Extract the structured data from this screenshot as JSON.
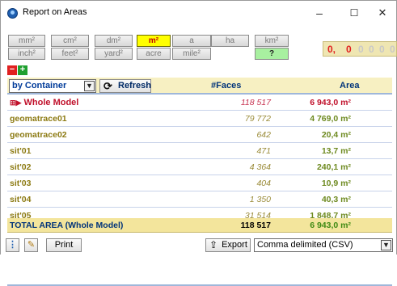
{
  "window": {
    "title": "Report on Areas",
    "minimize": "–",
    "maximize": "☐",
    "close": "✕"
  },
  "units": {
    "row1": [
      "mm²",
      "cm²",
      "dm²",
      "m²",
      "a",
      "ha",
      "km²"
    ],
    "row2": [
      "inch²",
      "feet²",
      "yard²",
      "acre",
      "mile²"
    ],
    "selected": "m²",
    "help_button": "?"
  },
  "digits": [
    "0,",
    "0",
    "0",
    "0",
    "0",
    "0"
  ],
  "toolbar": {
    "remove_label": "−",
    "add_label": "+"
  },
  "grid": {
    "group_by_value": "by Container",
    "refresh_label": "Refresh",
    "col_faces": "#Faces",
    "col_area": "Area",
    "rows": [
      {
        "name": "Whole Model",
        "faces": "118 517",
        "area": "6 943,0 m²"
      },
      {
        "name": "geomatrace01",
        "faces": "79 772",
        "area": "4 769,0 m²"
      },
      {
        "name": "geomatrace02",
        "faces": "642",
        "area": "20,4 m²"
      },
      {
        "name": "sit'01",
        "faces": "471",
        "area": "13,7 m²"
      },
      {
        "name": "sit'02",
        "faces": "4 364",
        "area": "240,1 m²"
      },
      {
        "name": "sit'03",
        "faces": "404",
        "area": "10,9 m²"
      },
      {
        "name": "sit'04",
        "faces": "1 350",
        "area": "40,3 m²"
      },
      {
        "name": "sit'05",
        "faces": "31 514",
        "area": "1 848,7 m²"
      }
    ],
    "total": {
      "name": "TOTAL AREA (Whole Model)",
      "faces": "118 517",
      "area": "6 943,0 m²"
    }
  },
  "bottom": {
    "print_label": "Print",
    "export_label": "Export",
    "format_value": "Comma delimited (CSV)"
  }
}
